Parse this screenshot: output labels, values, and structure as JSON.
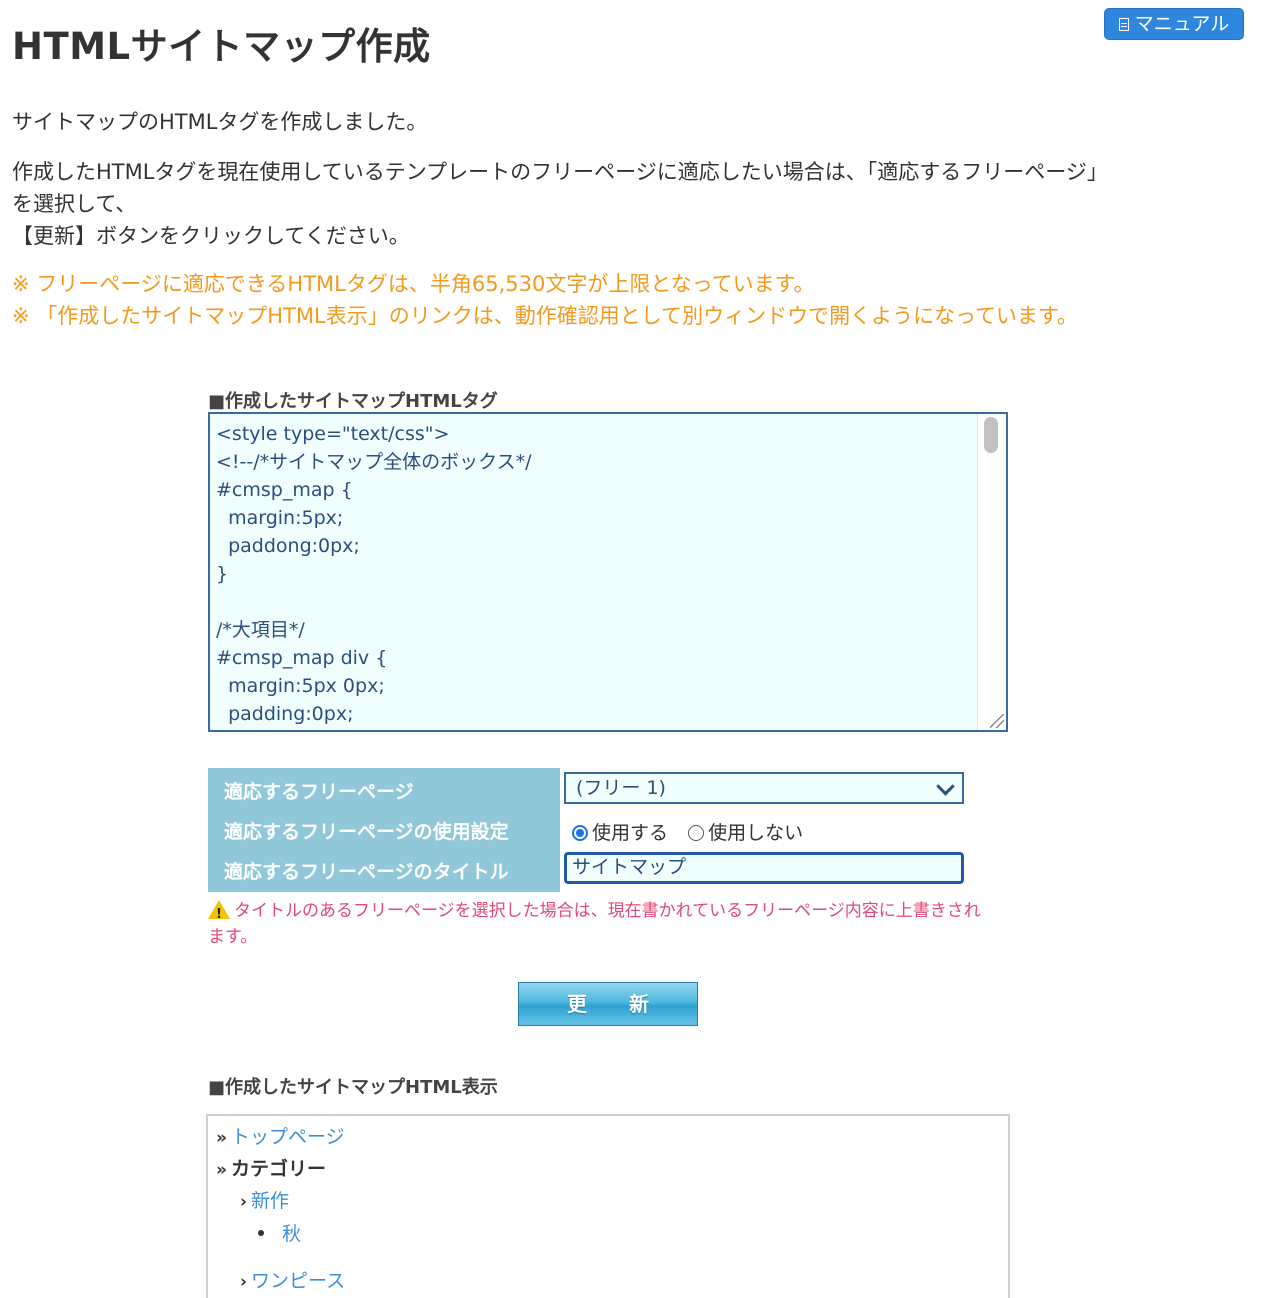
{
  "header": {
    "title": "HTMLサイトマップ作成",
    "manual_button": "マニュアル"
  },
  "intro": {
    "line1": "サイトマップのHTMLタグを作成しました。",
    "line2": "作成したHTMLタグを現在使用しているテンプレートのフリーページに適応したい場合は、「適応するフリーページ」",
    "line3": "を選択して、",
    "line4": "【更新】ボタンをクリックしてください。"
  },
  "notes": [
    "※ フリーページに適応できるHTMLタグは、半角65,530文字が上限となっています。",
    "※ 「作成したサイトマップHTML表示」のリンクは、動作確認用として別ウィンドウで開くようになっています。"
  ],
  "code_section": {
    "heading": "■作成したサイトマップHTMLタグ",
    "lines": [
      "<style type=\"text/css\">",
      "<!--/*サイトマップ全体のボックス*/",
      "#cmsp_map {",
      "  margin:5px;",
      "  paddong:0px;",
      "}",
      "",
      "/*大項目*/",
      "#cmsp_map div {",
      "  margin:5px 0px;",
      "  padding:0px;"
    ]
  },
  "settings": {
    "label_free_page": "適応するフリーページ",
    "label_usage": "適応するフリーページの使用設定",
    "label_title": "適応するフリーページのタイトル",
    "free_page_selected": "(フリー 1)",
    "usage_option_use": "使用する",
    "usage_option_not_use": "使用しない",
    "usage_selected": "使用する",
    "title_value": "サイトマップ"
  },
  "warning": {
    "line1": "タイトルのあるフリーページを選択した場合は、現在書かれているフリーページ内容に上書きされ",
    "line2": "ます。"
  },
  "update_button": "更新",
  "preview_section": {
    "heading": "■作成したサイトマップHTML表示",
    "items": {
      "top_page": "トップページ",
      "category": "カテゴリー",
      "new": "新作",
      "autumn": "秋",
      "onepiece": "ワンピース"
    }
  }
}
